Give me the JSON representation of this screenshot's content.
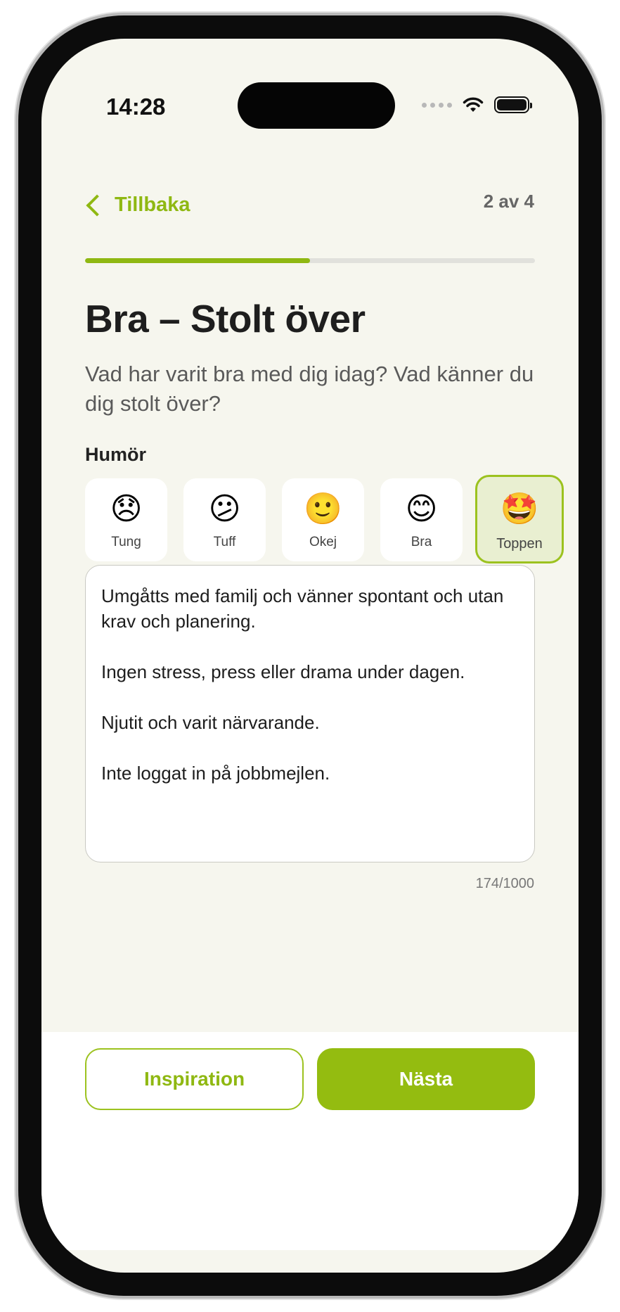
{
  "status_bar": {
    "time": "14:28"
  },
  "nav": {
    "back_label": "Tillbaka",
    "step": "2 av 4"
  },
  "progress": {
    "fraction": 0.5
  },
  "header": {
    "title": "Bra – Stolt över",
    "subtitle": "Vad har varit bra med dig idag? Vad känner du dig stolt över?"
  },
  "mood": {
    "label": "Humör",
    "options": [
      {
        "emoji": "😞",
        "label": "Tung"
      },
      {
        "emoji": "😕",
        "label": "Tuff"
      },
      {
        "emoji": "🙂",
        "label": "Okej"
      },
      {
        "emoji": "😊",
        "label": "Bra"
      },
      {
        "emoji": "🤩",
        "label": "Toppen"
      }
    ],
    "selected": "Toppen"
  },
  "entry": {
    "text": "Umgåtts med familj och vänner spontant och utan krav och planering.\n\nIngen stress, press eller drama under dagen.\n\nNjutit och varit närvarande.\n\nInte loggat in på jobbmejlen.",
    "counter": "174/1000"
  },
  "buttons": {
    "inspiration": "Inspiration",
    "next": "Nästa"
  },
  "colors": {
    "accent": "#94bc10",
    "background": "#f6f6ee"
  }
}
